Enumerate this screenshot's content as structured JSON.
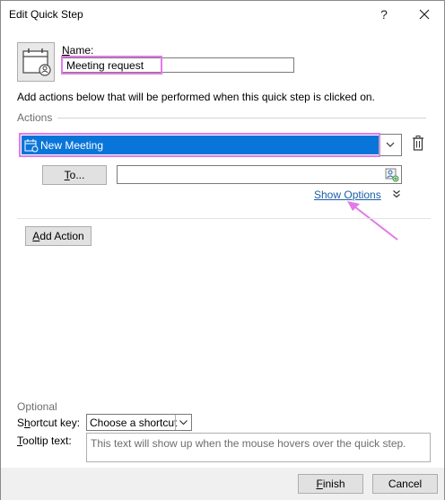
{
  "window": {
    "title": "Edit Quick Step",
    "help_label": "?"
  },
  "name_section": {
    "label_accel": "N",
    "label_rest": "ame:",
    "value": "Meeting request"
  },
  "description": "Add actions below that will be performed when this quick step is clicked on.",
  "actions": {
    "group_label": "Actions",
    "selected_action": "New Meeting",
    "to_button_accel": "T",
    "to_button_rest": "o...",
    "to_value": "",
    "show_options_pre": "Show ",
    "show_options_accel": "O",
    "show_options_post": "ptions",
    "add_action_accel": "A",
    "add_action_rest": "dd Action"
  },
  "optional": {
    "group_label": "Optional",
    "shortcut_label_pre": "S",
    "shortcut_label_accel": "h",
    "shortcut_label_post": "ortcut key:",
    "shortcut_value": "Choose a shortcut",
    "tooltip_label_pre": "T",
    "tooltip_label_accel": "o",
    "tooltip_label_post": "oltip text:",
    "tooltip_placeholder": "This text will show up when the mouse hovers over the quick step."
  },
  "footer": {
    "finish_accel": "F",
    "finish_rest": "inish",
    "cancel_label": "Cancel"
  },
  "colors": {
    "highlight_annotation": "#e27ae9",
    "selection_blue": "#0a75d8",
    "link_blue": "#1b5ea8"
  },
  "icons": {
    "quick_step": "calendar-icon",
    "action": "meeting-icon",
    "address_book": "address-book-icon",
    "delete": "trash-icon",
    "close": "close-icon",
    "dropdown": "chevron-down-icon",
    "expand": "double-chevron-down-icon"
  }
}
